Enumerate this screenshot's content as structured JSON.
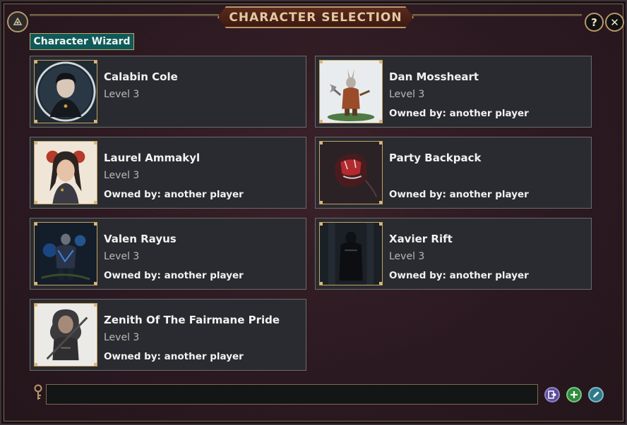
{
  "window": {
    "title": "CHARACTER SELECTION",
    "help_label": "?",
    "close_label": "✕"
  },
  "wizard_tab": {
    "label": "Character Wizard"
  },
  "characters": [
    {
      "name": "Calabin Cole",
      "level": "Level 3",
      "owner": ""
    },
    {
      "name": "Dan Mossheart",
      "level": "Level 3",
      "owner": "Owned by: another player"
    },
    {
      "name": "Laurel Ammakyl",
      "level": "Level 3",
      "owner": "Owned by: another player"
    },
    {
      "name": "Party Backpack",
      "level": "",
      "owner": "Owned by: another player"
    },
    {
      "name": "Valen Rayus",
      "level": "Level 3",
      "owner": "Owned by: another player"
    },
    {
      "name": "Xavier Rift",
      "level": "Level 3",
      "owner": "Owned by: another player"
    },
    {
      "name": "Zenith Of The Fairmane Pride",
      "level": "Level 3",
      "owner": "Owned by: another player"
    }
  ],
  "chat": {
    "value": "",
    "placeholder": ""
  },
  "icons": {
    "search": "key-search-icon",
    "import": "import-icon",
    "add": "plus-icon",
    "edit": "pencil-icon"
  },
  "colors": {
    "accent_gold": "#b8976a",
    "wizard_tab": "#0e5a58",
    "card_bg": "#2a2b30",
    "import_button": "#5b4b9a",
    "add_button": "#2e8b3a",
    "edit_button": "#2f7a8a"
  }
}
